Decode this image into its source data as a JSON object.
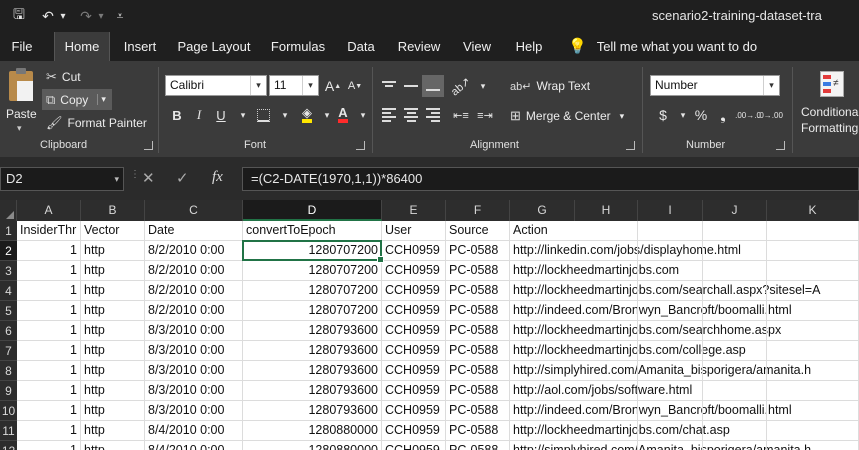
{
  "window": {
    "title": "scenario2-training-dataset-tra"
  },
  "quick_access": [
    {
      "name": "save-icon",
      "glyph": "🖫"
    },
    {
      "name": "undo-icon",
      "glyph": "↶"
    },
    {
      "name": "undo-dropdown-icon",
      "glyph": "▾"
    },
    {
      "name": "redo-icon",
      "glyph": "↷"
    },
    {
      "name": "redo-dropdown-icon",
      "glyph": "▾"
    },
    {
      "name": "customize-qat-icon",
      "glyph": "⩡"
    }
  ],
  "menu": {
    "tabs": [
      "File",
      "Home",
      "Insert",
      "Page Layout",
      "Formulas",
      "Data",
      "Review",
      "View",
      "Help"
    ],
    "active": "Home",
    "tell_me": "Tell me what you want to do",
    "bulb_glyph": "💡"
  },
  "ribbon": {
    "clipboard": {
      "paste_label": "Paste",
      "cut_label": "Cut",
      "copy_label": "Copy",
      "format_painter_label": "Format Painter",
      "group_label": "Clipboard"
    },
    "font": {
      "font_name": "Calibri",
      "font_size": "11",
      "grow_glyph": "A",
      "shrink_glyph": "A",
      "bold": "B",
      "italic": "I",
      "underline": "U",
      "font_color_glyph": "A",
      "group_label": "Font"
    },
    "alignment": {
      "wrap_text_label": "Wrap Text",
      "merge_center_label": "Merge & Center",
      "group_label": "Alignment"
    },
    "number": {
      "format": "Number",
      "currency_glyph": "$",
      "percent_glyph": "%",
      "comma_glyph": "❟",
      "inc_decimal": ".00→.0",
      "dec_decimal": ".0→.00",
      "group_label": "Number"
    },
    "styles": {
      "conditional_label_1": "Conditional",
      "conditional_label_2": "Formatting"
    }
  },
  "formula_bar": {
    "name_box": "D2",
    "cancel_glyph": "✕",
    "enter_glyph": "✓",
    "fx_glyph": "fx",
    "formula": "=(C2-DATE(1970,1,1))*86400"
  },
  "sheet": {
    "columns": [
      "A",
      "B",
      "C",
      "D",
      "E",
      "F",
      "G",
      "H",
      "I",
      "J",
      "K"
    ],
    "selected_column": "D",
    "selected_row": "2",
    "row_numbers": [
      "1",
      "2",
      "3",
      "4",
      "5",
      "6",
      "7",
      "8",
      "9",
      "10",
      "11",
      "12"
    ],
    "header_row": [
      "InsiderThr",
      "Vector",
      "Date",
      "convertToEpoch",
      "User",
      "Source",
      "Action"
    ],
    "rows": [
      [
        "1",
        "http",
        "8/2/2010 0:00",
        "1280707200",
        "CCH0959",
        "PC-0588",
        "http://linkedin.com/jobs/displayhome.html"
      ],
      [
        "1",
        "http",
        "8/2/2010 0:00",
        "1280707200",
        "CCH0959",
        "PC-0588",
        "http://lockheedmartinjobs.com"
      ],
      [
        "1",
        "http",
        "8/2/2010 0:00",
        "1280707200",
        "CCH0959",
        "PC-0588",
        "http://lockheedmartinjobs.com/searchall.aspx?sitesel=A"
      ],
      [
        "1",
        "http",
        "8/2/2010 0:00",
        "1280707200",
        "CCH0959",
        "PC-0588",
        "http://indeed.com/Bronwyn_Bancroft/boomalli.html"
      ],
      [
        "1",
        "http",
        "8/3/2010 0:00",
        "1280793600",
        "CCH0959",
        "PC-0588",
        "http://lockheedmartinjobs.com/searchhome.aspx"
      ],
      [
        "1",
        "http",
        "8/3/2010 0:00",
        "1280793600",
        "CCH0959",
        "PC-0588",
        "http://lockheedmartinjobs.com/college.asp"
      ],
      [
        "1",
        "http",
        "8/3/2010 0:00",
        "1280793600",
        "CCH0959",
        "PC-0588",
        "http://simplyhired.com/Amanita_bisporigera/amanita.h"
      ],
      [
        "1",
        "http",
        "8/3/2010 0:00",
        "1280793600",
        "CCH0959",
        "PC-0588",
        "http://aol.com/jobs/software.html"
      ],
      [
        "1",
        "http",
        "8/3/2010 0:00",
        "1280793600",
        "CCH0959",
        "PC-0588",
        "http://indeed.com/Bronwyn_Bancroft/boomalli.html"
      ],
      [
        "1",
        "http",
        "8/4/2010 0:00",
        "1280880000",
        "CCH0959",
        "PC-0588",
        "http://lockheedmartinjobs.com/chat.asp"
      ],
      [
        "1",
        "http",
        "8/4/2010 0:00",
        "1280880000",
        "CCH0959",
        "PC-0588",
        "http://simplyhired.com/Amanita_bisporigera/amanita.h"
      ]
    ]
  }
}
